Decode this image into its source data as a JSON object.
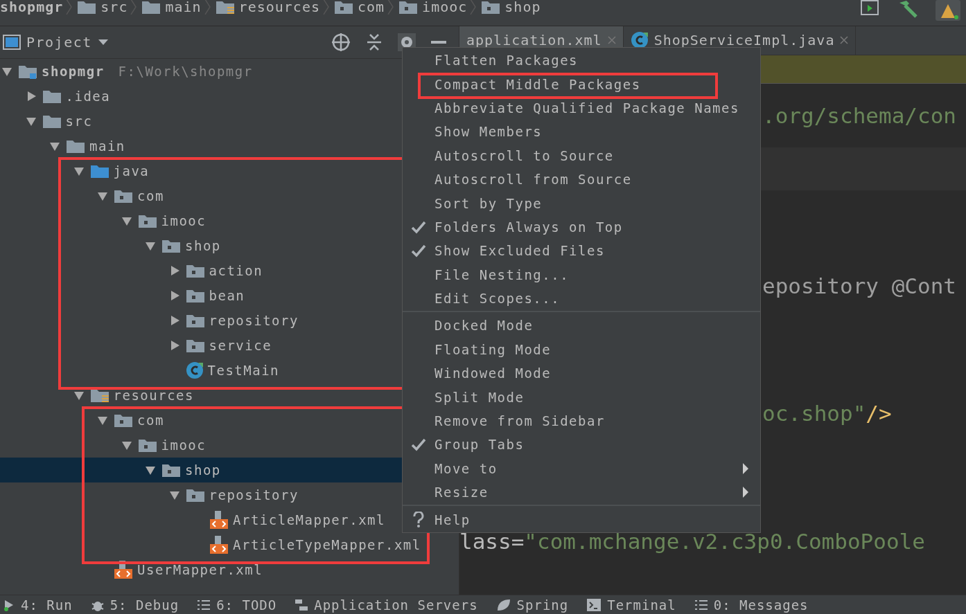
{
  "breadcrumbs": [
    {
      "label": "shopmgr",
      "kind": "module"
    },
    {
      "label": "src",
      "kind": "folder"
    },
    {
      "label": "main",
      "kind": "folder"
    },
    {
      "label": "resources",
      "kind": "resource_root"
    },
    {
      "label": "com",
      "kind": "package"
    },
    {
      "label": "imooc",
      "kind": "package"
    },
    {
      "label": "shop",
      "kind": "package"
    }
  ],
  "project_panel": {
    "title": "Project"
  },
  "tree": [
    {
      "label": "shopmgr",
      "path": "F:\\Work\\shopmgr",
      "kind": "module",
      "expanded": true,
      "selected": false,
      "highlighted": false,
      "children": [
        {
          "label": ".idea",
          "kind": "folder",
          "expanded": false,
          "selected": false,
          "highlighted": false
        },
        {
          "label": "src",
          "kind": "folder",
          "expanded": true,
          "selected": false,
          "highlighted": false,
          "children": [
            {
              "label": "main",
              "kind": "folder",
              "expanded": true,
              "selected": false,
              "highlighted": false,
              "children": [
                {
                  "label": "java",
                  "kind": "source_root",
                  "expanded": true,
                  "selected": false,
                  "highlighted": true,
                  "children": [
                    {
                      "label": "com",
                      "kind": "package",
                      "expanded": true,
                      "selected": false,
                      "highlighted": false,
                      "children": [
                        {
                          "label": "imooc",
                          "kind": "package",
                          "expanded": true,
                          "selected": false,
                          "highlighted": false,
                          "children": [
                            {
                              "label": "shop",
                              "kind": "package",
                              "expanded": true,
                              "selected": false,
                              "highlighted": false,
                              "children": [
                                {
                                  "label": "action",
                                  "kind": "package",
                                  "expanded": false,
                                  "selected": false,
                                  "highlighted": false
                                },
                                {
                                  "label": "bean",
                                  "kind": "package",
                                  "expanded": false,
                                  "selected": false,
                                  "highlighted": false
                                },
                                {
                                  "label": "repository",
                                  "kind": "package",
                                  "expanded": false,
                                  "selected": false,
                                  "highlighted": false
                                },
                                {
                                  "label": "service",
                                  "kind": "package",
                                  "expanded": false,
                                  "selected": false,
                                  "highlighted": false
                                },
                                {
                                  "label": "TestMain",
                                  "kind": "class",
                                  "selected": false,
                                  "highlighted": false
                                }
                              ]
                            }
                          ]
                        }
                      ]
                    }
                  ]
                },
                {
                  "label": "resources",
                  "kind": "resource_root",
                  "expanded": true,
                  "selected": false,
                  "highlighted": false,
                  "children": [
                    {
                      "label": "com",
                      "kind": "package",
                      "expanded": true,
                      "selected": false,
                      "highlighted": true,
                      "children": [
                        {
                          "label": "imooc",
                          "kind": "package",
                          "expanded": true,
                          "selected": false,
                          "highlighted": false,
                          "children": [
                            {
                              "label": "shop",
                              "kind": "package",
                              "expanded": true,
                              "selected": true,
                              "highlighted": false,
                              "children": [
                                {
                                  "label": "repository",
                                  "kind": "package",
                                  "expanded": true,
                                  "selected": false,
                                  "highlighted": false,
                                  "children": [
                                    {
                                      "label": "ArticleMapper.xml",
                                      "kind": "xml",
                                      "selected": false,
                                      "highlighted": false
                                    },
                                    {
                                      "label": "ArticleTypeMapper.xml",
                                      "kind": "xml",
                                      "selected": false,
                                      "highlighted": false
                                    }
                                  ]
                                }
                              ]
                            }
                          ]
                        }
                      ]
                    },
                    {
                      "label": "UserMapper.xml",
                      "kind": "xml",
                      "selected": false,
                      "highlighted": false
                    }
                  ]
                }
              ]
            }
          ]
        }
      ]
    }
  ],
  "editor_tabs": [
    {
      "label": "application.xml",
      "kind": "xml",
      "selected": true
    },
    {
      "label": "ShopServiceImpl.java",
      "kind": "class",
      "selected": false
    }
  ],
  "code_lines": [
    {
      "segments": [
        {
          "text": ".org/schema/con",
          "kind": "string"
        }
      ]
    },
    {
      "segments": [
        {
          "text": "epository @Cont",
          "kind": "plain"
        }
      ]
    },
    {
      "segments": [
        {
          "text": "oc.shop\"",
          "kind": "string"
        },
        {
          "text": "/>",
          "kind": "tag"
        }
      ]
    },
    {
      "segments": [
        {
          "text": "lass=",
          "kind": "attr"
        },
        {
          "text": "\"com.mchange.v2.c3p0.ComboPoole",
          "kind": "string"
        }
      ]
    }
  ],
  "menu": {
    "groups": [
      [
        {
          "label": "Flatten Packages",
          "checked": false,
          "submenu": false,
          "highlighted": false
        },
        {
          "label": "Compact Middle Packages",
          "checked": false,
          "submenu": false,
          "highlighted": true
        },
        {
          "label": "Abbreviate Qualified Package Names",
          "checked": false,
          "submenu": false,
          "highlighted": false
        },
        {
          "label": "Show Members",
          "checked": false,
          "submenu": false,
          "highlighted": false
        },
        {
          "label": "Autoscroll to Source",
          "checked": false,
          "submenu": false,
          "highlighted": false
        },
        {
          "label": "Autoscroll from Source",
          "checked": false,
          "submenu": false,
          "highlighted": false
        },
        {
          "label": "Sort by Type",
          "checked": false,
          "submenu": false,
          "highlighted": false
        },
        {
          "label": "Folders Always on Top",
          "checked": true,
          "submenu": false,
          "highlighted": false
        },
        {
          "label": "Show Excluded Files",
          "checked": true,
          "submenu": false,
          "highlighted": false
        },
        {
          "label": "File Nesting...",
          "checked": false,
          "submenu": false,
          "highlighted": false
        },
        {
          "label": "Edit Scopes...",
          "checked": false,
          "submenu": false,
          "highlighted": false
        }
      ],
      [
        {
          "label": "Docked Mode",
          "checked": false,
          "submenu": false,
          "highlighted": false
        },
        {
          "label": "Floating Mode",
          "checked": false,
          "submenu": false,
          "highlighted": false
        },
        {
          "label": "Windowed Mode",
          "checked": false,
          "submenu": false,
          "highlighted": false
        },
        {
          "label": "Split Mode",
          "checked": false,
          "submenu": false,
          "highlighted": false
        },
        {
          "label": "Remove from Sidebar",
          "checked": false,
          "submenu": false,
          "highlighted": false
        },
        {
          "label": "Group Tabs",
          "checked": true,
          "submenu": false,
          "highlighted": false
        },
        {
          "label": "Move to",
          "checked": false,
          "submenu": true,
          "highlighted": false
        },
        {
          "label": "Resize",
          "checked": false,
          "submenu": true,
          "highlighted": false
        }
      ],
      [
        {
          "label": "Help",
          "checked": false,
          "submenu": false,
          "highlighted": false,
          "kind": "help"
        }
      ]
    ]
  },
  "tool_windows": [
    {
      "label": "4: Run"
    },
    {
      "label": "5: Debug"
    },
    {
      "label": "6: TODO"
    },
    {
      "label": "Application Servers"
    },
    {
      "label": "Spring"
    },
    {
      "label": "Terminal"
    },
    {
      "label": "0: Messages"
    }
  ]
}
